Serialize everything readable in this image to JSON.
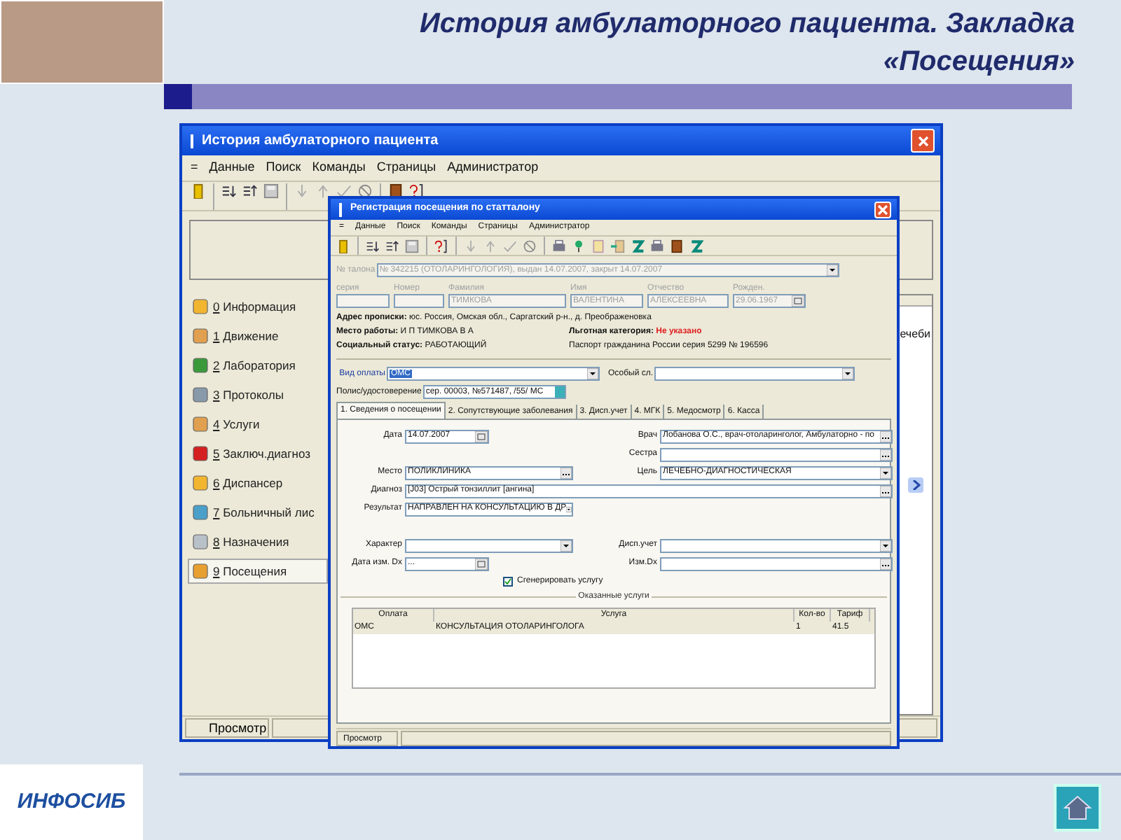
{
  "slide": {
    "title_lines": [
      "История амбулаторного пациента. Закладка",
      "«Посещения»"
    ],
    "logo": "ИНФОСИБ"
  },
  "main_window": {
    "title": "История амбулаторного пациента",
    "menu": [
      "=",
      "Данные",
      "Поиск",
      "Команды",
      "Страницы",
      "Администратор"
    ],
    "sidebar": [
      {
        "label": "0 Информация",
        "selected": false
      },
      {
        "label": "1 Движение",
        "selected": false
      },
      {
        "label": "2 Лаборатория",
        "selected": false
      },
      {
        "label": "3 Протоколы",
        "selected": false
      },
      {
        "label": "4 Услуги",
        "selected": false
      },
      {
        "label": "5 Заключ.диагноз",
        "selected": false
      },
      {
        "label": "6 Диспансер",
        "selected": false
      },
      {
        "label": "7 Больничный лис",
        "selected": false
      },
      {
        "label": "8 Назначения",
        "selected": false
      },
      {
        "label": "9 Посещения",
        "selected": true
      }
    ],
    "grid_fragment": "ечеби",
    "status": "Просмотр"
  },
  "dialog": {
    "title": "Регистрация посещения по статталону",
    "menu": [
      "=",
      "Данные",
      "Поиск",
      "Команды",
      "Страницы",
      "Администратор"
    ],
    "ticket": {
      "label": "№ талона",
      "value": "№ 342215 (ОТОЛАРИНГОЛОГИЯ), выдан 14.07.2007, закрыт 14.07.2007",
      "disabled": true
    },
    "patient": {
      "disabled": true,
      "fields": [
        {
          "label": "серия"
        },
        {
          "label": "Номер"
        },
        {
          "label": "Фамилия",
          "value": "ТИМКОВА"
        },
        {
          "label": "Имя",
          "value": "ВАЛЕНТИНА"
        },
        {
          "label": "Отчество",
          "value": "АЛЕКСЕЕВНА"
        },
        {
          "label": "Рожден.",
          "value": "29.06.1967"
        }
      ]
    },
    "address": {
      "label": "Адрес прописки:",
      "value": "юс. Россия, Омская обл., Саргатский р-н., д. Преображеновка"
    },
    "info_rows": [
      {
        "left": {
          "label": "Место работы:",
          "value": "И П ТИМКОВА В А"
        },
        "right": {
          "label": "Льготная категория:",
          "value": "Не указано",
          "warning": true
        }
      },
      {
        "left": {
          "label": "Социальный статус:",
          "value": "РАБОТАЮЩИЙ"
        },
        "right": {
          "value": "Паспорт гражданина России серия 5299 № 196596",
          "warning": false
        }
      }
    ],
    "payment": {
      "label": "Вид оплаты",
      "value": "ОМС",
      "value_selected": true
    },
    "special": {
      "label": "Особый сл."
    },
    "policy": {
      "label": "Полис/удостоверение",
      "value": "сер. 00003, №571487, /55/ МС"
    },
    "tabs": [
      {
        "label": "1. Сведения о посещении",
        "selected": true
      },
      {
        "label": "2. Сопутствующие заболевания",
        "selected": false
      },
      {
        "label": "3. Дисп.учет",
        "selected": false
      },
      {
        "label": "4. МГК",
        "selected": false
      },
      {
        "label": "5. Медосмотр",
        "selected": false
      },
      {
        "label": "6. Касса",
        "selected": false
      }
    ],
    "form_rows": [
      {
        "left": {
          "label": "Дата",
          "value": "14.07.2007",
          "kind": "date"
        },
        "right": {
          "label": "Врач",
          "value": "Лобанова О.С., врач-отоларинголог, Амбулаторно - по",
          "kind": "lookup"
        }
      },
      {
        "right": {
          "label": "Сестра",
          "kind": "lookup"
        }
      },
      {
        "left": {
          "label": "Место",
          "value": "ПОЛИКЛИНИКА",
          "kind": "lookup"
        },
        "right": {
          "label": "Цель",
          "value": "ЛЕЧЕБНО-ДИАГНОСТИЧЕСКАЯ",
          "kind": "combo"
        }
      },
      {
        "full": {
          "label": "Диагноз",
          "value": "[J03] Острый тонзиллит [ангина]",
          "kind": "lookup"
        }
      },
      {
        "left": {
          "label": "Результат",
          "value": "НАПРАВЛЕН НА КОНСУЛЬТАЦИЮ В ДР",
          "kind": "combo"
        }
      },
      {},
      {
        "left": {
          "label": "Характер",
          "kind": "combo"
        },
        "right": {
          "label": "Дисп.учет",
          "kind": "combo"
        }
      },
      {
        "left": {
          "label": "Дата изм. Dx",
          "value": "...",
          "kind": "date"
        },
        "right": {
          "label": "Изм.Dx",
          "kind": "lookup"
        }
      }
    ],
    "generate": {
      "label": "Сгенерировать услугу",
      "checked": true
    },
    "services": {
      "title": "Оказанные услуги",
      "columns": [
        "Оплата",
        "Услуга",
        "Кол-во",
        "Тариф"
      ],
      "rows": [
        [
          "ОМС",
          "КОНСУЛЬТАЦИЯ ОТОЛАРИНГОЛОГА",
          "1",
          "41.5"
        ]
      ]
    },
    "status": "Просмотр"
  }
}
